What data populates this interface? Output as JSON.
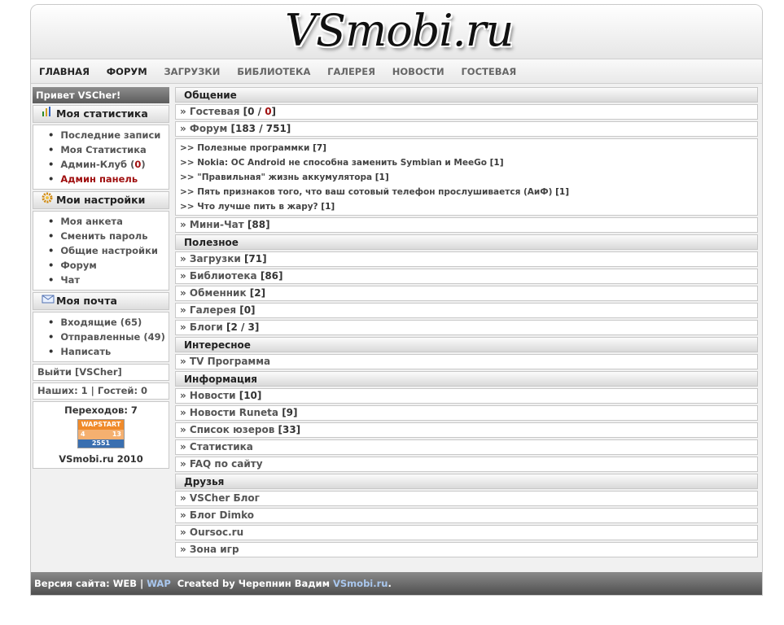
{
  "logo": "VSmobi.ru",
  "nav": [
    "ГЛАВНАЯ",
    "ФОРУМ",
    "ЗАГРУЗКИ",
    "БИБЛИОТЕКА",
    "ГАЛЕРЕЯ",
    "НОВОСТИ",
    "ГОСТЕВАЯ"
  ],
  "sidebar": {
    "greeting": "Привет VSCher!",
    "stats": {
      "title": "Моя статистика",
      "items": [
        "Последние записи",
        "Моя Статистика",
        "Админ-Клуб (",
        "0",
        ")",
        "Админ панель"
      ]
    },
    "settings": {
      "title": "Мои настройки",
      "items": [
        "Моя анкета",
        "Сменить пароль",
        "Общие настройки",
        "Форум",
        "Чат"
      ]
    },
    "mail": {
      "title": "Моя почта",
      "items": [
        "Входящие (65)",
        "Отправленные (49)",
        "Написать"
      ]
    },
    "logout": "Выйти [VSCher]",
    "online": "Наших: 1 | Гостей: 0",
    "transitions": "Переходов: 7",
    "counter_badge": {
      "title": "WAPSTART",
      "left": "4",
      "right": "13",
      "bottom": "2551"
    },
    "copyright": "VSmobi.ru 2010"
  },
  "main": {
    "sec_general": "Общение",
    "guestbook_label": "» Гостевая ",
    "guestbook_count_a": "[0 / ",
    "guestbook_count_b": "0",
    "guestbook_count_c": "]",
    "forum_label": "» Форум ",
    "forum_count": "[183 / 751]",
    "forum_topics": [
      {
        "title": ">> Полезные программки ",
        "count": "[7]"
      },
      {
        "title": ">> Nokia: ОС Android не способна заменить Symbian и MeeGo ",
        "count": "[1]"
      },
      {
        "title": ">> \"Правильная\" жизнь аккумулятора ",
        "count": "[1]"
      },
      {
        "title": ">> Пять признаков того, что ваш сотовый телефон прослушивается (АиФ) ",
        "count": "[1]"
      },
      {
        "title": ">> Что лучше пить в жару? ",
        "count": "[1]"
      }
    ],
    "minichat_label": "» Мини-Чат ",
    "minichat_count": "[88]",
    "sec_useful": "Полезное",
    "useful": [
      {
        "label": "» Загрузки ",
        "count": "[71]"
      },
      {
        "label": "» Библиотека ",
        "count": "[86]"
      },
      {
        "label": "» Обменник ",
        "count": "[2]"
      },
      {
        "label": "» Галерея ",
        "count": "[0]"
      },
      {
        "label": "» Блоги ",
        "count": "[2 / 3]"
      }
    ],
    "sec_interesting": "Интересное",
    "tv": "» TV Программа",
    "sec_info": "Информация",
    "info": [
      {
        "label": "» Новости ",
        "count": "[10]"
      },
      {
        "label": "» Новости Runeta ",
        "count": "[9]"
      },
      {
        "label": "» Список юзеров ",
        "count": "[33]"
      },
      {
        "label": "» Статистика",
        "count": ""
      },
      {
        "label": "» FAQ по сайту",
        "count": ""
      }
    ],
    "sec_friends": "Друзья",
    "friends": [
      "» VSCher Блог",
      "» Блог Dimko",
      "» Oursoc.ru",
      "» Зона игр"
    ]
  },
  "footer": {
    "prefix": "Версия сайта: WEB | ",
    "wap": "WAP",
    "created": "  Created by Черепнин Вадим ",
    "site": "VSmobi.ru",
    "dot": "."
  }
}
